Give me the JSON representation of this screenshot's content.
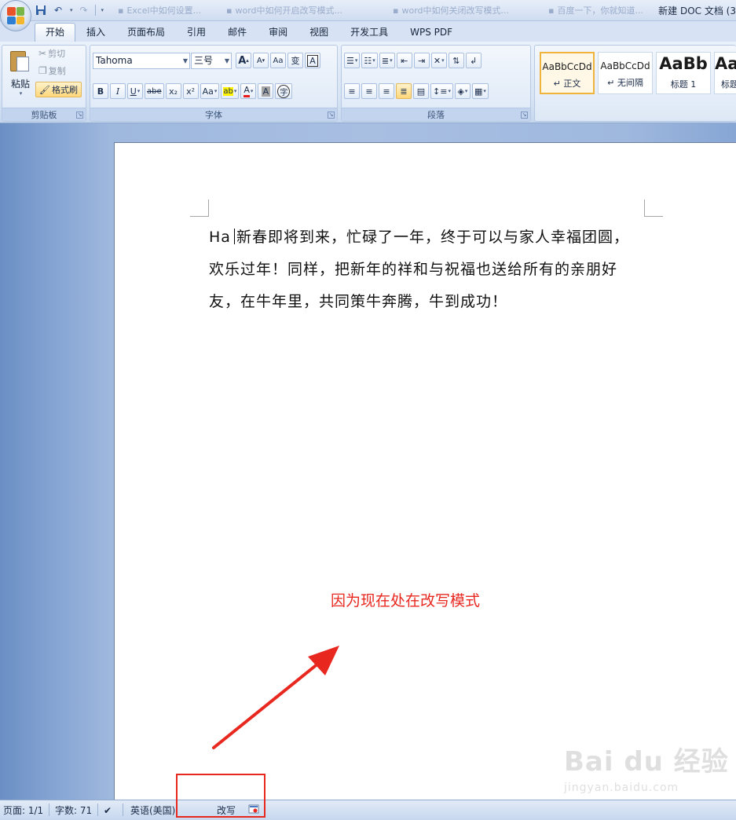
{
  "window": {
    "title": "新建 DOC 文档 (3"
  },
  "quick_access": {
    "icons": [
      "save-icon",
      "undo-icon",
      "redo-icon",
      "customize-icon"
    ]
  },
  "ghost_tabs": [
    {
      "label": "Excel中如何设置...",
      "icon": "document-icon"
    },
    {
      "label": "word中如何开启改写模式...",
      "icon": "document-icon"
    },
    {
      "label": "word中如何关闭改写模式...",
      "icon": "document-icon"
    },
    {
      "label": "百度一下，你就知道...",
      "icon": "document-icon"
    }
  ],
  "ribbon": {
    "tabs": [
      "开始",
      "插入",
      "页面布局",
      "引用",
      "邮件",
      "审阅",
      "视图",
      "开发工具",
      "WPS PDF"
    ],
    "active_tab": "开始",
    "clipboard": {
      "label": "剪贴板",
      "paste": "粘贴",
      "cut": "剪切",
      "copy": "复制",
      "format_painter": "格式刷"
    },
    "font": {
      "label": "字体",
      "font_name": "Tahoma",
      "font_size": "三号",
      "grow": "A",
      "shrink": "A",
      "phonetic": "变",
      "border_char": "A",
      "bold": "B",
      "italic": "I",
      "underline": "U",
      "strike": "abe",
      "subscript": "x₂",
      "superscript": "x²",
      "case": "Aa",
      "highlight": "ab",
      "font_color": "A",
      "shading_char": "A",
      "enclose": "字"
    },
    "paragraph": {
      "label": "段落"
    },
    "styles": {
      "tiles": [
        {
          "sample": "AaBbCcDd",
          "name": "↵ 正文",
          "selected": true
        },
        {
          "sample": "AaBbCcDd",
          "name": "↵ 无间隔",
          "selected": false
        },
        {
          "sample": "AaBb",
          "name": "标题 1",
          "selected": false
        },
        {
          "sample": "AaI",
          "name": "标题",
          "selected": false
        }
      ]
    }
  },
  "document": {
    "lead": "Ha",
    "lines": [
      "新春即将到来，忙碌了一年，终于可以与家人幸福团圆，",
      "欢乐过年！同样，把新年的祥和与祝福也送给所有的亲朋好",
      "友，在牛年里，共同策牛奔腾，牛到成功！"
    ]
  },
  "annotation": {
    "text": "因为现在处在改写模式",
    "color": "#e8271f"
  },
  "watermark": {
    "logo": "Bai du 经验",
    "sub": "jingyan.baidu.com"
  },
  "status": {
    "page": "页面: 1/1",
    "words": "字数: 71",
    "language": "英语(美国)",
    "overtype": "改写"
  },
  "colors": {
    "accent": "#e8271f",
    "ribbon": "#d8e4f4",
    "workspace": "#9fb8de"
  }
}
